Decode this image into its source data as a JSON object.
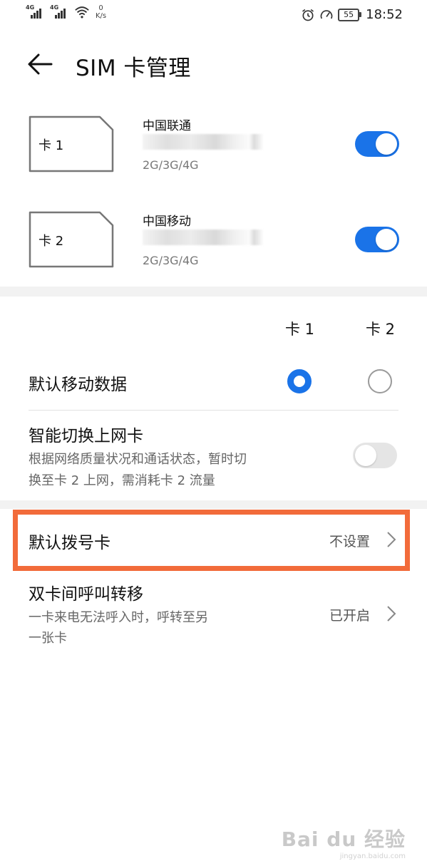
{
  "status_bar": {
    "sim1_network": "4G",
    "sim2_network": "4G",
    "speed_value": "0",
    "speed_unit": "K/s",
    "battery_level": "55",
    "time": "18:52"
  },
  "header": {
    "title": "SIM 卡管理"
  },
  "sim_cards": [
    {
      "card_label": "卡 1",
      "carrier": "中国联通",
      "network_types": "2G/3G/4G",
      "enabled": true
    },
    {
      "card_label": "卡 2",
      "carrier": "中国移动",
      "network_types": "2G/3G/4G",
      "enabled": true
    }
  ],
  "columns": {
    "card1": "卡 1",
    "card2": "卡 2"
  },
  "default_mobile_data": {
    "label": "默认移动数据",
    "selected": "card1"
  },
  "smart_switch": {
    "label": "智能切换上网卡",
    "desc_line1": "根据网络质量状况和通话状态，暂时切",
    "desc_line2": "换至卡 2 上网，需消耗卡 2 流量",
    "enabled": false
  },
  "default_dial": {
    "label": "默认拨号卡",
    "value": "不设置"
  },
  "call_forward": {
    "label": "双卡间呼叫转移",
    "desc_line1": "一卡来电无法呼入时，呼转至另",
    "desc_line2": "一张卡",
    "value": "已开启"
  },
  "watermark": {
    "main": "Bai du 经验",
    "sub": "jingyan.baidu.com"
  },
  "colors": {
    "accent": "#1a73e8",
    "highlight": "#f26b3a"
  }
}
